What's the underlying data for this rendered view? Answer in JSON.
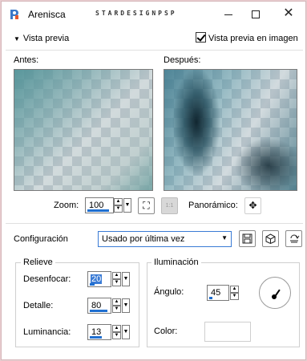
{
  "window": {
    "title": "Arenisca",
    "watermark": "STARDESIGNPSP",
    "controls": {
      "minimize": "",
      "maximize": "",
      "close": "✕"
    }
  },
  "preview": {
    "toggle_label": "Vista previa",
    "checkbox_label": "Vista previa en imagen",
    "checkbox_checked": true,
    "before_label": "Antes:",
    "after_label": "Después:"
  },
  "zoom": {
    "label": "Zoom:",
    "value": "100",
    "panoramic_label": "Panorámico:"
  },
  "config": {
    "label": "Configuración",
    "selected": "Usado por última vez"
  },
  "relieve": {
    "title": "Relieve",
    "fields": [
      {
        "label": "Desenfocar:",
        "value": "20"
      },
      {
        "label": "Detalle:",
        "value": "80"
      },
      {
        "label": "Luminancia:",
        "value": "13"
      }
    ]
  },
  "iluminacion": {
    "title": "Iluminación",
    "angle_label": "Ángulo:",
    "angle_value": "45",
    "color_label": "Color:",
    "color_value": "#ffffff"
  },
  "colors": {
    "accent": "#1f6fd0",
    "frame_background": "#e9cdd0"
  }
}
